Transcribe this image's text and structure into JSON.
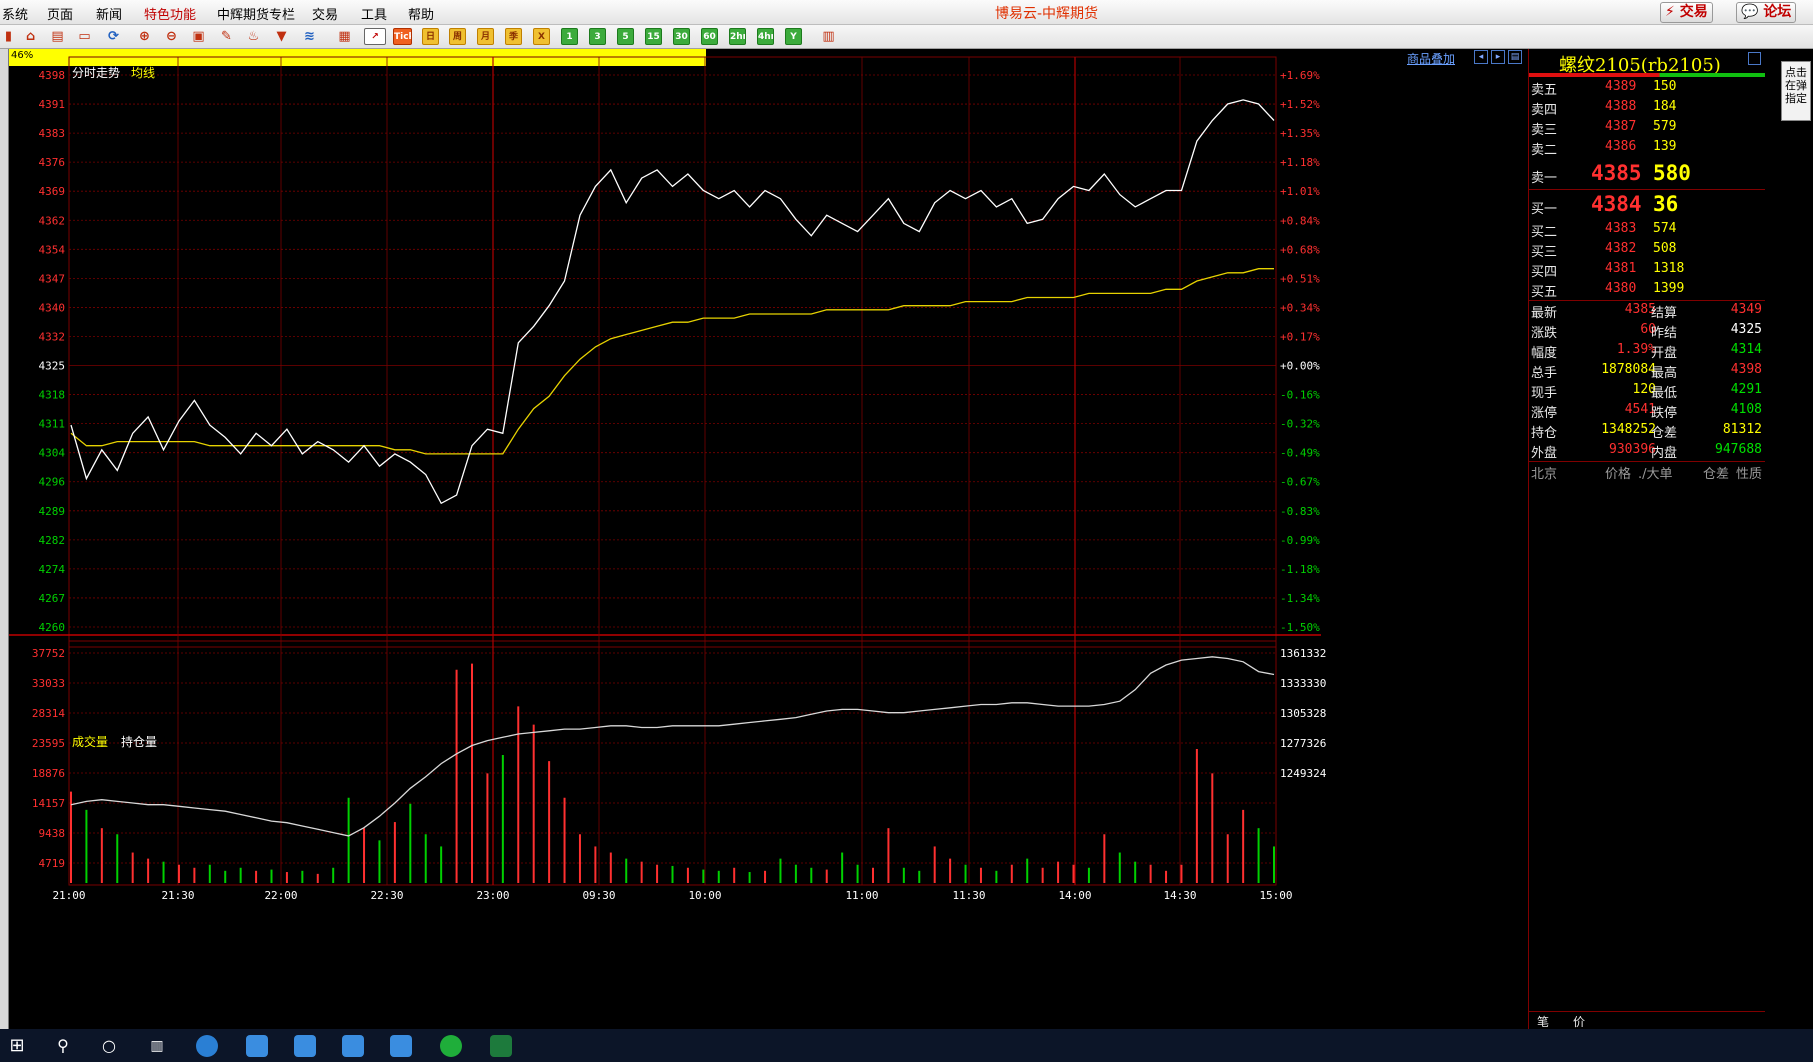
{
  "window": {
    "title": "博易云-中辉期货",
    "menus": [
      "系统",
      "页面",
      "新闻",
      "特色功能",
      "中辉期货专栏",
      "交易",
      "工具",
      "帮助"
    ],
    "highlight_menu": "特色功能",
    "trade_button": "交易",
    "forum_button": "论坛"
  },
  "toolbar": {
    "tick_label": "Tick",
    "period_labels": [
      "日",
      "周",
      "月",
      "季",
      "X",
      "1",
      "3",
      "5",
      "15",
      "30",
      "60",
      "2hr",
      "4hr",
      "Y"
    ]
  },
  "status": {
    "progress_text": "46%",
    "progress_value": 0.46,
    "overlay_link": "商品叠加"
  },
  "chart_data": [
    {
      "type": "line",
      "title": "分时走势",
      "series_label": "均线",
      "y_ticks": [
        "4398",
        "4391",
        "4383",
        "4376",
        "4369",
        "4362",
        "4354",
        "4347",
        "4340",
        "4332",
        "4325",
        "4318",
        "4311",
        "4304",
        "4296",
        "4289",
        "4282",
        "4274",
        "4267",
        "4260"
      ],
      "pct_ticks": [
        "+1.69%",
        "+1.52%",
        "+1.35%",
        "+1.18%",
        "+1.01%",
        "+0.84%",
        "+0.68%",
        "+0.51%",
        "+0.34%",
        "+0.17%",
        "+0.00%",
        "-0.16%",
        "-0.32%",
        "-0.49%",
        "-0.67%",
        "-0.83%",
        "-0.99%",
        "-1.18%",
        "-1.34%",
        "-1.50%"
      ],
      "ylim": [
        4260,
        4398
      ],
      "baseline": 4325,
      "time_labels": [
        "21:00",
        "21:30",
        "22:00",
        "22:30",
        "23:00",
        "09:30",
        "10:00",
        "11:00",
        "11:30",
        "14:00",
        "14:30",
        "15:00"
      ],
      "price": [
        4311,
        4298,
        4305,
        4300,
        4309,
        4313,
        4305,
        4312,
        4317,
        4311,
        4308,
        4304,
        4309,
        4306,
        4310,
        4304,
        4307,
        4305,
        4302,
        4306,
        4301,
        4304,
        4302,
        4299,
        4292,
        4294,
        4306,
        4310,
        4309,
        4331,
        4335,
        4340,
        4346,
        4362,
        4369,
        4373,
        4365,
        4371,
        4373,
        4369,
        4372,
        4368,
        4366,
        4368,
        4364,
        4368,
        4366,
        4361,
        4357,
        4362,
        4360,
        4358,
        4362,
        4366,
        4360,
        4358,
        4365,
        4368,
        4366,
        4368,
        4364,
        4366,
        4360,
        4361,
        4366,
        4369,
        4368,
        4372,
        4367,
        4364,
        4366,
        4368,
        4368,
        4380,
        4385,
        4389,
        4390,
        4389,
        4385
      ],
      "average": [
        4309,
        4306,
        4306,
        4307,
        4307,
        4307,
        4307,
        4307,
        4307,
        4306,
        4306,
        4306,
        4306,
        4306,
        4306,
        4306,
        4306,
        4306,
        4306,
        4306,
        4306,
        4305,
        4305,
        4304,
        4304,
        4304,
        4304,
        4304,
        4304,
        4310,
        4315,
        4318,
        4323,
        4327,
        4330,
        4332,
        4333,
        4334,
        4335,
        4336,
        4336,
        4337,
        4337,
        4337,
        4338,
        4338,
        4338,
        4338,
        4338,
        4339,
        4339,
        4339,
        4339,
        4339,
        4340,
        4340,
        4340,
        4340,
        4341,
        4341,
        4341,
        4341,
        4342,
        4342,
        4342,
        4342,
        4343,
        4343,
        4343,
        4343,
        4343,
        4344,
        4344,
        4346,
        4347,
        4348,
        4348,
        4349,
        4349
      ]
    },
    {
      "type": "bar",
      "title": "成交量",
      "series_label": "持仓量",
      "y_ticks": [
        "37752",
        "33033",
        "28314",
        "23595",
        "18876",
        "14157",
        "9438",
        "4719"
      ],
      "oi_ticks": [
        "1361332",
        "1333330",
        "1305328",
        "1277326",
        "1249324"
      ],
      "ylim": [
        0,
        37752
      ],
      "oi_lim": [
        1221322,
        1361332
      ],
      "volume": [
        15000,
        12000,
        9000,
        8000,
        5000,
        4000,
        3500,
        3000,
        2500,
        3000,
        2000,
        2500,
        2000,
        2200,
        1800,
        2000,
        1500,
        2500,
        14000,
        9000,
        7000,
        10000,
        13000,
        8000,
        6000,
        35000,
        36000,
        18000,
        21000,
        29000,
        26000,
        20000,
        14000,
        8000,
        6000,
        5000,
        4000,
        3500,
        3000,
        2800,
        2500,
        2200,
        2000,
        2500,
        1800,
        2000,
        4000,
        3000,
        2500,
        2200,
        5000,
        3000,
        2500,
        9000,
        2500,
        2000,
        6000,
        4000,
        3000,
        2500,
        2000,
        3000,
        4000,
        2500,
        3500,
        3000,
        2500,
        8000,
        5000,
        3500,
        3000,
        2000,
        3000,
        22000,
        18000,
        8000,
        12000,
        9000,
        6000
      ],
      "open_interest": [
        1269000,
        1271000,
        1272000,
        1271000,
        1270000,
        1269000,
        1269000,
        1268000,
        1267000,
        1266000,
        1265000,
        1263000,
        1261000,
        1259000,
        1258000,
        1256000,
        1254000,
        1252000,
        1250000,
        1255000,
        1262000,
        1270000,
        1279000,
        1286000,
        1294000,
        1300000,
        1305000,
        1308000,
        1310000,
        1312000,
        1313000,
        1314000,
        1315000,
        1315000,
        1316000,
        1317000,
        1317000,
        1316000,
        1316000,
        1317000,
        1317000,
        1317000,
        1317000,
        1318000,
        1319000,
        1320000,
        1321000,
        1322000,
        1324000,
        1326000,
        1327000,
        1327000,
        1326000,
        1325000,
        1325000,
        1326000,
        1327000,
        1328000,
        1329000,
        1330000,
        1330000,
        1331000,
        1331000,
        1330000,
        1329000,
        1329000,
        1329000,
        1330000,
        1332000,
        1339000,
        1349000,
        1354000,
        1357000,
        1358000,
        1359000,
        1358000,
        1356000,
        1350000,
        1348252
      ]
    }
  ],
  "quote": {
    "name": "螺纹2105(rb2105)",
    "asks": [
      {
        "label": "卖五",
        "price": "4389",
        "vol": "150"
      },
      {
        "label": "卖四",
        "price": "4388",
        "vol": "184"
      },
      {
        "label": "卖三",
        "price": "4387",
        "vol": "579"
      },
      {
        "label": "卖二",
        "price": "4386",
        "vol": "139"
      },
      {
        "label": "卖一",
        "price": "4385",
        "vol": "580"
      }
    ],
    "bids": [
      {
        "label": "买一",
        "price": "4384",
        "vol": "36"
      },
      {
        "label": "买二",
        "price": "4383",
        "vol": "574"
      },
      {
        "label": "买三",
        "price": "4382",
        "vol": "508"
      },
      {
        "label": "买四",
        "price": "4381",
        "vol": "1318"
      },
      {
        "label": "买五",
        "price": "4380",
        "vol": "1399"
      }
    ],
    "stats": [
      {
        "l1": "最新",
        "v1": "4385",
        "c1": "red",
        "l2": "结算",
        "v2": "4349",
        "c2": "red"
      },
      {
        "l1": "涨跌",
        "v1": "60",
        "c1": "red",
        "l2": "昨结",
        "v2": "4325",
        "c2": "wht"
      },
      {
        "l1": "幅度",
        "v1": "1.39%",
        "c1": "red",
        "l2": "开盘",
        "v2": "4314",
        "c2": "grn"
      },
      {
        "l1": "总手",
        "v1": "1878084",
        "c1": "yel",
        "l2": "最高",
        "v2": "4398",
        "c2": "red"
      },
      {
        "l1": "现手",
        "v1": "120",
        "c1": "yel",
        "l2": "最低",
        "v2": "4291",
        "c2": "grn"
      },
      {
        "l1": "涨停",
        "v1": "4541",
        "c1": "red",
        "l2": "跌停",
        "v2": "4108",
        "c2": "grn"
      },
      {
        "l1": "持仓",
        "v1": "1348252",
        "c1": "yel",
        "l2": "仓差",
        "v2": "81312",
        "c2": "yel"
      },
      {
        "l1": "外盘",
        "v1": "930396",
        "c1": "red",
        "l2": "内盘",
        "v2": "947688",
        "c2": "grn"
      }
    ],
    "tick_header": {
      "city": "北京",
      "price": "价格",
      "vol": "./大单",
      "oi_diff": "仓差",
      "nature": "性质"
    },
    "bottom_tabs": [
      "笔",
      "价"
    ]
  },
  "side_button": "点击在弹指定",
  "colors": {
    "grid": "#7a0000",
    "axis_red": "#ff3030",
    "axis_green": "#00d000",
    "price_line": "#ffffff",
    "avg_line": "#e6d200",
    "vol_up": "#ff3030",
    "vol_down": "#00d000"
  }
}
